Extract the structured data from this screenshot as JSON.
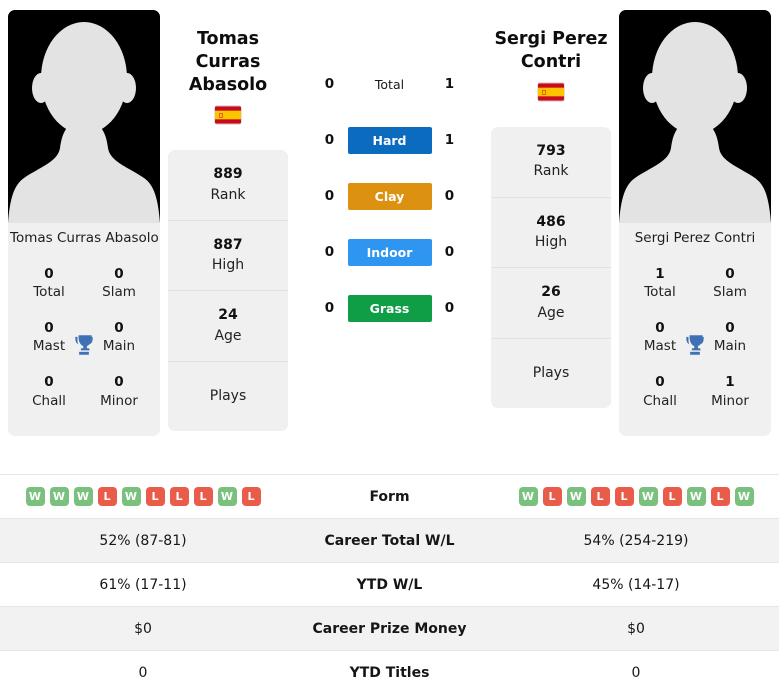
{
  "players": {
    "left": {
      "name": "Tomas Curras Abasolo",
      "name_line1": "Tomas Curras",
      "name_line2": "Abasolo",
      "flag": "spain-flag",
      "photo_caption": "Tomas Curras Abasolo",
      "stats": [
        {
          "value": "889",
          "label": "Rank"
        },
        {
          "value": "887",
          "label": "High"
        },
        {
          "value": "24",
          "label": "Age"
        },
        {
          "value": "",
          "label": "Plays"
        }
      ],
      "titles": [
        {
          "value": "0",
          "label": "Total"
        },
        {
          "value": "0",
          "label": "Slam"
        },
        {
          "value": "0",
          "label": "Mast"
        },
        {
          "value": "0",
          "label": "Main"
        },
        {
          "value": "0",
          "label": "Chall"
        },
        {
          "value": "0",
          "label": "Minor"
        }
      ],
      "form": [
        "W",
        "W",
        "W",
        "L",
        "W",
        "L",
        "L",
        "L",
        "W",
        "L"
      ]
    },
    "right": {
      "name": "Sergi Perez Contri",
      "name_line1": "Sergi Perez",
      "name_line2": "Contri",
      "flag": "spain-flag",
      "photo_caption": "Sergi Perez Contri",
      "stats": [
        {
          "value": "793",
          "label": "Rank"
        },
        {
          "value": "486",
          "label": "High"
        },
        {
          "value": "26",
          "label": "Age"
        },
        {
          "value": "",
          "label": "Plays"
        }
      ],
      "titles": [
        {
          "value": "1",
          "label": "Total"
        },
        {
          "value": "0",
          "label": "Slam"
        },
        {
          "value": "0",
          "label": "Mast"
        },
        {
          "value": "0",
          "label": "Main"
        },
        {
          "value": "0",
          "label": "Chall"
        },
        {
          "value": "1",
          "label": "Minor"
        }
      ],
      "form": [
        "W",
        "L",
        "W",
        "L",
        "L",
        "W",
        "L",
        "W",
        "L",
        "W"
      ]
    }
  },
  "head_to_head": [
    {
      "label": "Total",
      "left": "0",
      "right": "1",
      "badge": false,
      "color": ""
    },
    {
      "label": "Hard",
      "left": "0",
      "right": "1",
      "badge": true,
      "color": "#0b6cbf"
    },
    {
      "label": "Clay",
      "left": "0",
      "right": "0",
      "badge": true,
      "color": "#dd9110"
    },
    {
      "label": "Indoor",
      "left": "0",
      "right": "0",
      "badge": true,
      "color": "#2e95f0"
    },
    {
      "label": "Grass",
      "left": "0",
      "right": "0",
      "badge": true,
      "color": "#0f9d46"
    }
  ],
  "comparison_rows": [
    {
      "label": "Form",
      "left": "",
      "right": "",
      "type": "form",
      "shaded": false
    },
    {
      "label": "Career Total W/L",
      "left": "52% (87-81)",
      "right": "54% (254-219)",
      "type": "text",
      "shaded": true
    },
    {
      "label": "YTD W/L",
      "left": "61% (17-11)",
      "right": "45% (14-17)",
      "type": "text",
      "shaded": false
    },
    {
      "label": "Career Prize Money",
      "left": "$0",
      "right": "$0",
      "type": "text",
      "shaded": true
    },
    {
      "label": "YTD Titles",
      "left": "0",
      "right": "0",
      "type": "text",
      "shaded": false
    }
  ],
  "colors": {
    "win": "#7ac17f",
    "loss": "#ea5c4a",
    "trophy": "#3f72b4",
    "card_bg": "#f0f0f0",
    "row_shaded": "#f2f2f2"
  },
  "icons": {
    "trophy": "trophy-icon",
    "avatar": "avatar-placeholder-icon"
  }
}
